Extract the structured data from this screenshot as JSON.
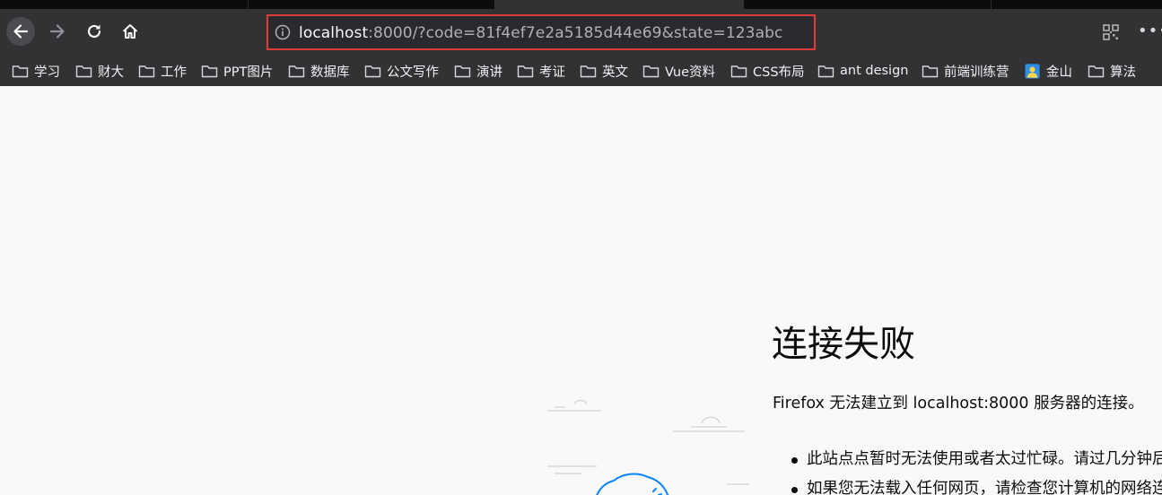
{
  "browser": {
    "url": {
      "host": "localhost",
      "rest": ":8000/?code=81f4ef7e2a5185d44e69&state=123abc"
    },
    "toolbar_icons": [
      "back-arrow-icon",
      "forward-arrow-icon",
      "reload-icon",
      "home-icon",
      "info-icon",
      "qr-code-icon",
      "more-icon"
    ],
    "more_label": "•••"
  },
  "bookmarks": [
    {
      "label": "学习",
      "icon": "folder-icon"
    },
    {
      "label": "财大",
      "icon": "folder-icon"
    },
    {
      "label": "工作",
      "icon": "folder-icon"
    },
    {
      "label": "PPT图片",
      "icon": "folder-icon"
    },
    {
      "label": "数据库",
      "icon": "folder-icon"
    },
    {
      "label": "公文写作",
      "icon": "folder-icon"
    },
    {
      "label": "演讲",
      "icon": "folder-icon"
    },
    {
      "label": "考证",
      "icon": "folder-icon"
    },
    {
      "label": "英文",
      "icon": "folder-icon"
    },
    {
      "label": "Vue资料",
      "icon": "folder-icon"
    },
    {
      "label": "CSS布局",
      "icon": "folder-icon"
    },
    {
      "label": "ant design",
      "icon": "folder-icon"
    },
    {
      "label": "前端训练营",
      "icon": "folder-icon"
    },
    {
      "label": "金山",
      "icon": "kingsoft-icon"
    },
    {
      "label": "算法",
      "icon": "folder-icon"
    }
  ],
  "error_page": {
    "title": "连接失败",
    "description": "Firefox 无法建立到 localhost:8000 服务器的连接。",
    "suggestions": [
      "此站点点暂时无法使用或者太过忙碌。请过几分钟后再试。",
      "如果您无法载入任何网页，请检查您计算机的网络连接。"
    ],
    "colors": {
      "accent": "#0a84ff",
      "text": "#0c0c0d"
    }
  }
}
